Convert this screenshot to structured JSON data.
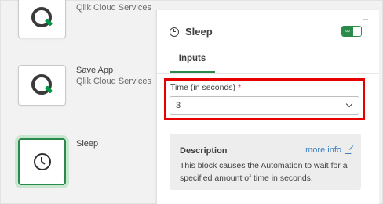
{
  "flow": {
    "blocks": [
      {
        "title": "",
        "subtitle": "Qlik Cloud Services",
        "icon": "qlik-q-icon"
      },
      {
        "title": "Save App",
        "subtitle": "Qlik Cloud Services",
        "icon": "qlik-q-icon"
      },
      {
        "title": "Sleep",
        "subtitle": "",
        "icon": "clock-icon",
        "selected": true
      }
    ]
  },
  "panel": {
    "minimize_glyph": "–",
    "title": "Sleep",
    "tabs": [
      {
        "label": "Inputs",
        "active": true
      }
    ],
    "field": {
      "label": "Time (in seconds)",
      "required_marker": "*",
      "value": "3"
    },
    "description": {
      "title": "Description",
      "link_label": "more info",
      "text": "This block causes the Automation to wait for a specified amount of time in seconds."
    }
  },
  "colors": {
    "accent_green": "#2a8a4a",
    "highlight_red": "#e60000",
    "link_blue": "#3f7fc1"
  }
}
